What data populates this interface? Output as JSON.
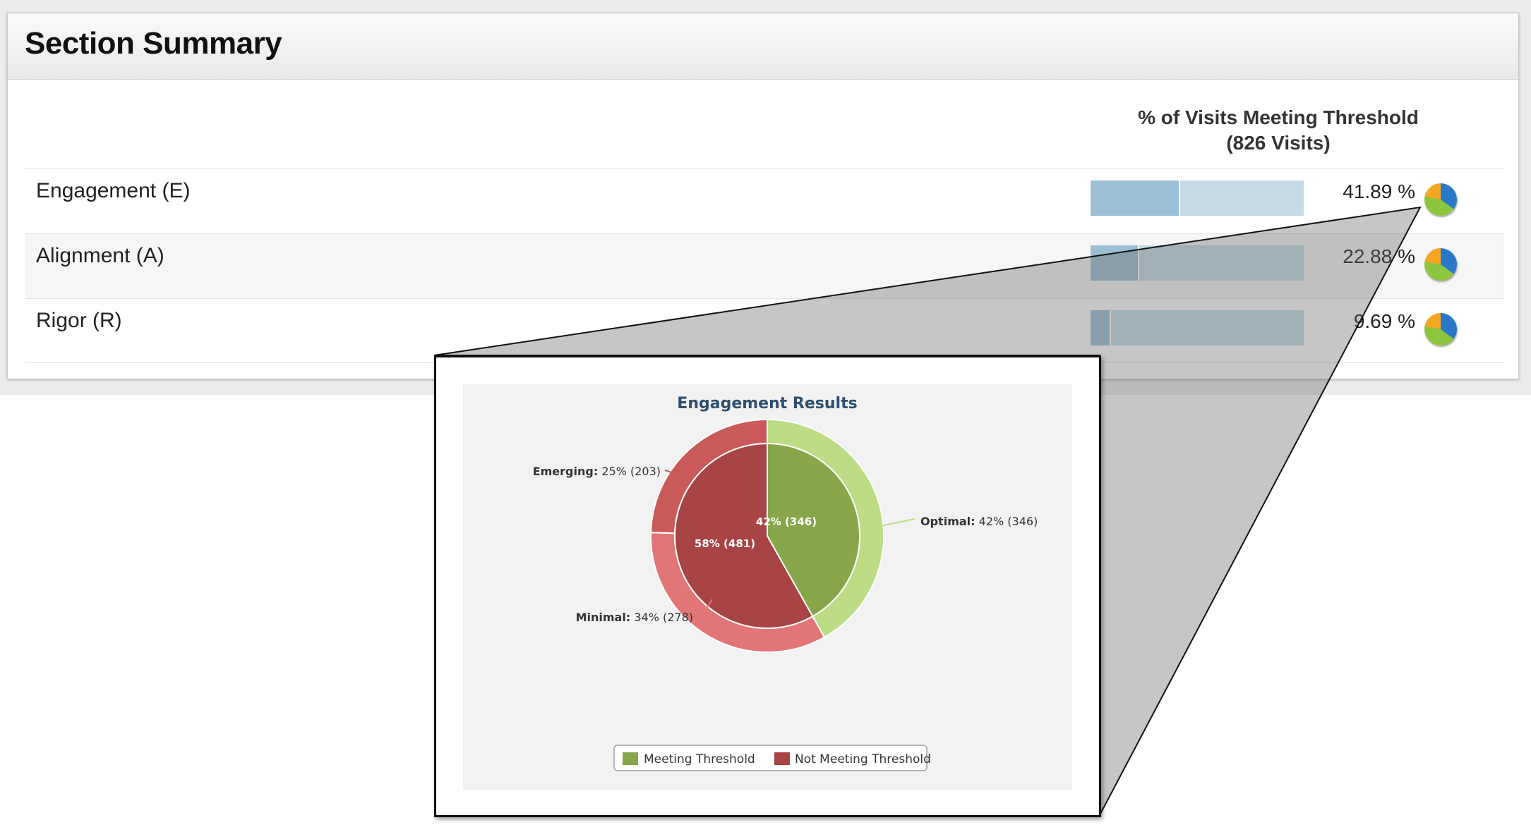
{
  "panel": {
    "title": "Section Summary"
  },
  "table": {
    "header_line1": "% of Visits Meeting Threshold",
    "header_line2": "(826 Visits)",
    "rows": [
      {
        "label": "Engagement (E)",
        "percent_text": "41.89 %",
        "fraction": 0.4189
      },
      {
        "label": "Alignment (A)",
        "percent_text": "22.88 %",
        "fraction": 0.2288
      },
      {
        "label": "Rigor (R)",
        "percent_text": "9.69 %",
        "fraction": 0.0969
      }
    ]
  },
  "colors": {
    "meeting_inner": "#87a64a",
    "meeting_outer": "#bcdc85",
    "not_meeting_inner": "#a84444",
    "not_meeting_outer_emerging": "#c95a58",
    "not_meeting_outer_minimal": "#e27576",
    "bar_fill": "#9bbfd4",
    "bar_track": "#c4dbe6"
  },
  "chart_data": {
    "type": "pie",
    "title": "Engagement Results",
    "inner": [
      {
        "name": "Meeting Threshold",
        "percent": 42,
        "count": 346,
        "label": "42% (346)"
      },
      {
        "name": "Not Meeting Threshold",
        "percent": 58,
        "count": 481,
        "label": "58% (481)"
      }
    ],
    "outer": [
      {
        "name": "Optimal",
        "percent": 42,
        "count": 346,
        "label_name": "Optimal:",
        "label_value": "42% (346)"
      },
      {
        "name": "Minimal",
        "percent": 34,
        "count": 278,
        "label_name": "Minimal:",
        "label_value": "34% (278)"
      },
      {
        "name": "Emerging",
        "percent": 25,
        "count": 203,
        "label_name": "Emerging:",
        "label_value": "25% (203)"
      }
    ],
    "legend": [
      "Meeting Threshold",
      "Not Meeting Threshold"
    ],
    "legend_placement": "bottom-center"
  }
}
